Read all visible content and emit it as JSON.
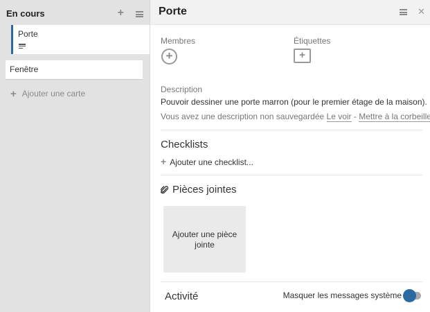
{
  "list": {
    "title": "En cours",
    "add_icon": "plus-icon",
    "menu_icon": "hamburger-icon",
    "cards": [
      {
        "title": "Porte",
        "has_description": true,
        "selected": true
      },
      {
        "title": "Fenêtre",
        "has_description": false,
        "selected": false
      }
    ],
    "add_card_label": "Ajouter une carte"
  },
  "detail": {
    "title": "Porte",
    "menu_icon": "hamburger-icon",
    "close_icon": "close-icon",
    "members_label": "Membres",
    "labels_label": "Étiquettes",
    "description": {
      "label": "Description",
      "text": "Pouvoir dessiner une porte marron (pour le premier étage de la maison).",
      "unsaved_prefix": "Vous avez une description non sauvegardée",
      "view_link": "Le voir",
      "separator": "-",
      "trash_link": "Mettre à la corbeille"
    },
    "checklists": {
      "title": "Checklists",
      "add_label": "Ajouter une checklist..."
    },
    "attachments": {
      "title": "Pièces jointes",
      "icon": "paperclip-icon",
      "add_label": "Ajouter une pièce jointe"
    },
    "activity": {
      "title": "Activité",
      "hide_system_label": "Masquer les messages système",
      "hide_system_enabled": true
    }
  },
  "colors": {
    "accent": "#2a6aa1",
    "list_bg": "#e2e2e2",
    "header_bg": "#f2f2f2"
  }
}
